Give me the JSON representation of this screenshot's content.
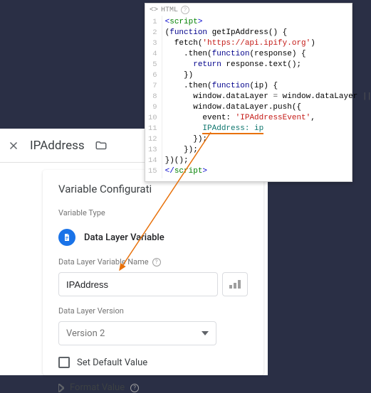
{
  "header": {
    "title": "IPAddress"
  },
  "card": {
    "title": "Variable Configurati",
    "type_label": "Variable Type",
    "type_name": "Data Layer Variable",
    "name_label": "Data Layer Variable Name",
    "name_value": "IPAddress",
    "version_label": "Data Layer Version",
    "version_value": "Version 2",
    "default_label": "Set Default Value",
    "format_label": "Format Value"
  },
  "code": {
    "tab_label": "HTML",
    "lines_count": 15,
    "lines": {
      "l1a": "<",
      "l1b": "script",
      "l1c": ">",
      "l2a": "(",
      "l2b": "function",
      "l2c": " getIpAddress() {",
      "l3a": "  fetch(",
      "l3b": "'https://api.ipify.org'",
      "l3c": ")",
      "l4a": "    .then(",
      "l4b": "function",
      "l4c": "(response) {",
      "l5a": "      ",
      "l5b": "return",
      "l5c": " response.text();",
      "l6": "    })",
      "l7a": "    .then(",
      "l7b": "function",
      "l7c": "(ip) {",
      "l8a": "      window.dataLayer ",
      "l8b": "=",
      "l8c": " window.dataLayer ",
      "l8d": "||",
      "l8e": " [];",
      "l9": "      window.dataLayer.push({",
      "l10a": "        event: ",
      "l10b": "'IPAddressEvent'",
      "l10c": ",",
      "l11a": "        ",
      "l11b": "IPAddress: ip",
      "l12": "      });",
      "l13": "    });",
      "l14": "})();",
      "l15a": "</",
      "l15b": "script",
      "l15c": ">"
    }
  }
}
